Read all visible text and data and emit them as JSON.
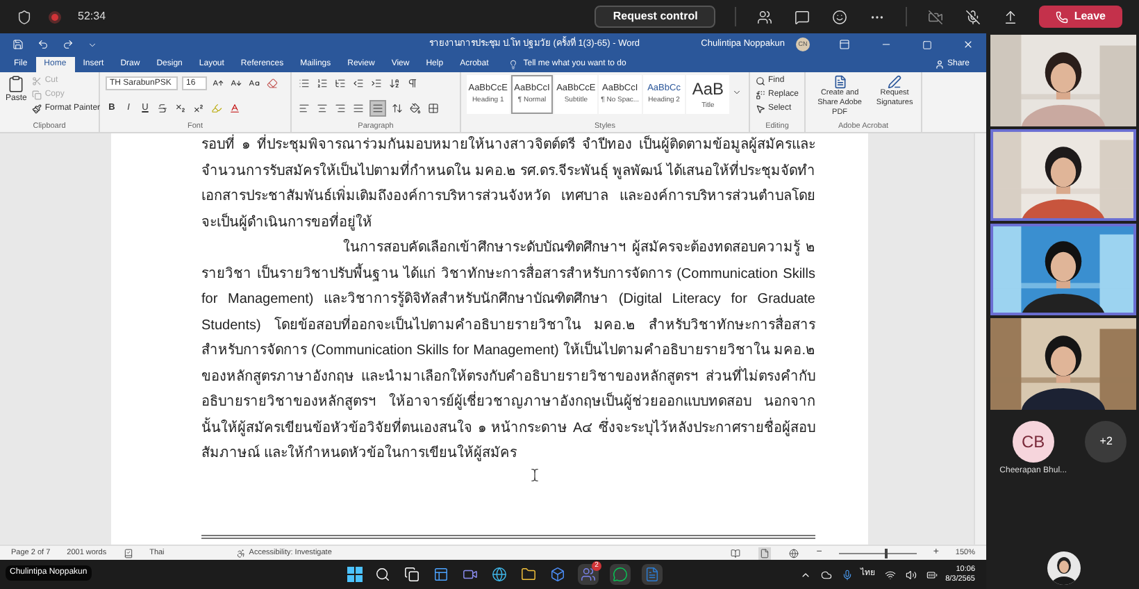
{
  "meeting_bar": {
    "elapsed": "52:34",
    "recording": true,
    "request_control": "Request control",
    "leave": "Leave"
  },
  "word": {
    "title": "รายงานการประชุม ป.โท ปฐมวัย (ครั้งที่ 1(3)-65)  -  Word",
    "user": "Chulintipa Noppakun",
    "user_initials": "CN",
    "tabs": [
      {
        "label": "File",
        "selected": false
      },
      {
        "label": "Home",
        "selected": true
      },
      {
        "label": "Insert",
        "selected": false
      },
      {
        "label": "Draw",
        "selected": false
      },
      {
        "label": "Design",
        "selected": false
      },
      {
        "label": "Layout",
        "selected": false
      },
      {
        "label": "References",
        "selected": false
      },
      {
        "label": "Mailings",
        "selected": false
      },
      {
        "label": "Review",
        "selected": false
      },
      {
        "label": "View",
        "selected": false
      },
      {
        "label": "Help",
        "selected": false
      },
      {
        "label": "Acrobat",
        "selected": false
      }
    ],
    "tell_me": "Tell me what you want to do",
    "share": "Share",
    "clipboard": {
      "paste": "Paste",
      "cut": "Cut",
      "copy": "Copy",
      "format_painter": "Format Painter",
      "label": "Clipboard",
      "cut_disabled": true,
      "copy_disabled": true
    },
    "font": {
      "name": "TH SarabunPSK",
      "size": "16",
      "bold": "B",
      "italic": "I",
      "underline": "U",
      "label": "Font"
    },
    "paragraph": {
      "align_buttons": [
        {
          "selected": false
        },
        {
          "selected": false
        },
        {
          "selected": false
        },
        {
          "selected": false
        },
        {
          "selected": true
        }
      ],
      "label": "Paragraph"
    },
    "styles": {
      "items": [
        {
          "preview": "AaBbCcE",
          "name": "Heading 1",
          "selected": false
        },
        {
          "preview": "AaBbCcI",
          "name": "¶ Normal",
          "selected": true
        },
        {
          "preview": "AaBbCcE",
          "name": "Subtitle",
          "selected": false
        },
        {
          "preview": "AaBbCcI",
          "name": "¶ No Spac...",
          "selected": false
        },
        {
          "preview": "AaBbCc",
          "name": "Heading 2",
          "selected": false
        },
        {
          "preview": "AaB",
          "name": "Title",
          "selected": false
        }
      ],
      "label": "Styles"
    },
    "editing": {
      "find": "Find",
      "replace": "Replace",
      "select": "Select",
      "label": "Editing"
    },
    "acrobat": {
      "create": "Create and Share Adobe PDF",
      "request": "Request Signatures",
      "label": "Adobe Acrobat"
    },
    "document": {
      "paragraphs": [
        {
          "indent": false,
          "text": "รอบที่ ๑ ที่ประชุมพิจารณาร่วมกันมอบหมายให้นางสาวจิตต์ตรี จำปีทอง เป็นผู้ติดตามข้อมูลผู้สมัครและจำนวนการรับสมัครให้เป็นไปตามที่กำหนดใน มคอ.๒ รศ.ดร.จีระพันธุ์ พูลพัฒน์ ได้เสนอให้ที่ประชุมจัดทำเอกสารประชาสัมพันธ์เพิ่มเติมถึงองค์การบริหารส่วนจังหวัด เทศบาล และองค์การบริหารส่วนตำบลโดยจะเป็นผู้ดำเนินการขอที่อยู่ให้"
        },
        {
          "indent": true,
          "text": "ในการสอบคัดเลือกเข้าศึกษาระดับบัณฑิตศึกษาฯ ผู้สมัครจะต้องทดสอบความรู้ ๒ รายวิชา เป็นรายวิชาปรับพื้นฐาน ได้แก่ วิชาทักษะการสื่อสารสำหรับการจัดการ (Communication Skills for Management) และวิชาการรู้ดิจิทัลสำหรับนักศึกษาบัณฑิตศึกษา (Digital Literacy for Graduate Students) โดยข้อสอบที่ออกจะเป็นไปตามคำอธิบายรายวิชาใน มคอ.๒  สำหรับวิชาทักษะการสื่อสารสำหรับการจัดการ (Communication Skills for Management) ให้เป็นไปตามคำอธิบายรายวิชาใน มคอ.๒ ของหลักสูตรภาษาอังกฤษ และนำมาเลือกให้ตรงกับคำอธิบายรายวิชาของหลักสูตรฯ ส่วนที่ไม่ตรงคำกับอธิบายรายวิชาของหลักสูตรฯ ให้อาจารย์ผู้เชี่ยวชาญภาษาอังกฤษเป็นผู้ช่วยออกแบบทดสอบ  นอกจากนั้นให้ผู้สมัครเขียนข้อหัวข้อวิจัยที่ตนเองสนใจ ๑ หน้ากระดาษ A๔ ซึ่งจะระบุไว้หลังประกาศรายชื่อผู้สอบสัมภาษณ์ และให้กำหนดหัวข้อในการเขียนให้ผู้สมัคร"
        }
      ]
    },
    "status_bar": {
      "page": "Page 2 of 7",
      "words": "2001 words",
      "language": "Thai",
      "accessibility": "Accessibility: Investigate",
      "zoom": "150%",
      "zoom_out": "−",
      "zoom_in": "+",
      "zoom_slider": {
        "level": 0.6
      }
    }
  },
  "taskbar": {
    "teams_badge": "2",
    "input_language": "ไทย",
    "time": "10:06",
    "date": "8/3/2565"
  },
  "presenter": "Chulintipa Noppakun",
  "participants": [
    {
      "kind": "video",
      "speaking": false
    },
    {
      "kind": "video",
      "speaking": true
    },
    {
      "kind": "video",
      "speaking": true
    },
    {
      "kind": "video",
      "speaking": false
    },
    {
      "kind": "avatar",
      "initials": "CB",
      "name": "Cheerapan Bhul..."
    },
    {
      "kind": "overflow",
      "label": "+2"
    }
  ]
}
